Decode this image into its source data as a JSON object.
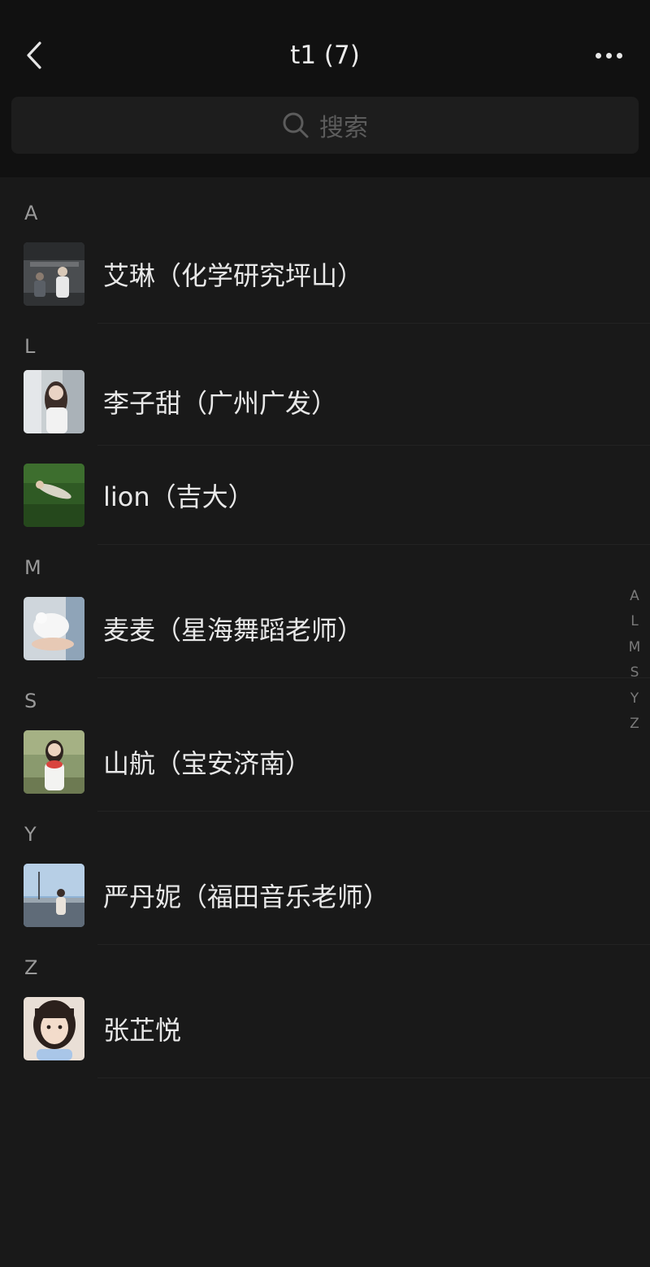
{
  "header": {
    "title": "t1 (7)",
    "back_icon": "chevron-left-icon",
    "more_icon": "more-dots-icon"
  },
  "search": {
    "label": "搜索",
    "icon": "search-icon"
  },
  "sections": [
    {
      "letter": "A",
      "contacts": [
        {
          "name": "艾琳（化学研究坪山）"
        }
      ]
    },
    {
      "letter": "L",
      "contacts": [
        {
          "name": "李子甜（广州广发）"
        },
        {
          "name": "lion（吉大）"
        }
      ]
    },
    {
      "letter": "M",
      "contacts": [
        {
          "name": "麦麦（星海舞蹈老师）"
        }
      ]
    },
    {
      "letter": "S",
      "contacts": [
        {
          "name": "山航（宝安济南）"
        }
      ]
    },
    {
      "letter": "Y",
      "contacts": [
        {
          "name": "严丹妮（福田音乐老师）"
        }
      ]
    },
    {
      "letter": "Z",
      "contacts": [
        {
          "name": "张芷悦"
        }
      ]
    }
  ],
  "index_letters": [
    "A",
    "L",
    "M",
    "S",
    "Y",
    "Z"
  ],
  "colors": {
    "background": "#191919",
    "header_background": "#111111",
    "text": "#e8e8e8",
    "secondary_text": "#9a9a9a"
  }
}
